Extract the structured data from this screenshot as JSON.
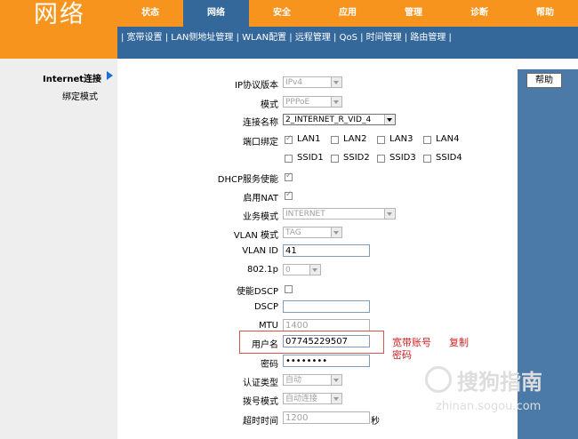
{
  "header": {
    "logo": "网络",
    "nav": [
      "状态",
      "网络",
      "安全",
      "应用",
      "管理",
      "诊断",
      "帮助"
    ],
    "active_nav": "网络",
    "subnav": "| 宽带设置 | LAN侧地址管理 | WLAN配置 | 远程管理 | QoS | 时间管理 | 路由管理 |"
  },
  "sidebar": {
    "items": [
      "Internet连接",
      "绑定模式"
    ]
  },
  "help_button": "帮助",
  "form": {
    "ip_version": {
      "label": "IP协议版本",
      "value": "IPv4"
    },
    "mode": {
      "label": "模式",
      "value": "PPPoE"
    },
    "connection_name": {
      "label": "连接名称",
      "value": "2_INTERNET_R_VID_4"
    },
    "port_binding": {
      "label": "端口绑定",
      "ports": [
        {
          "name": "LAN1",
          "checked": true
        },
        {
          "name": "LAN2",
          "checked": false
        },
        {
          "name": "LAN3",
          "checked": false
        },
        {
          "name": "LAN4",
          "checked": false
        },
        {
          "name": "SSID1",
          "checked": false
        },
        {
          "name": "SSID2",
          "checked": false
        },
        {
          "name": "SSID3",
          "checked": false
        },
        {
          "name": "SSID4",
          "checked": false
        }
      ]
    },
    "dhcp": {
      "label": "DHCP服务使能",
      "checked": true
    },
    "nat": {
      "label": "启用NAT",
      "checked": true
    },
    "service_mode": {
      "label": "业务模式",
      "value": "INTERNET"
    },
    "vlan_mode": {
      "label": "VLAN 模式",
      "value": "TAG"
    },
    "vlan_id": {
      "label": "VLAN ID",
      "value": "41"
    },
    "dot1p": {
      "label": "802.1p",
      "value": "0"
    },
    "dscp_enable": {
      "label": "使能DSCP",
      "checked": false
    },
    "dscp": {
      "label": "DSCP",
      "value": ""
    },
    "mtu": {
      "label": "MTU",
      "value": "1400"
    },
    "username": {
      "label": "用户名",
      "value": "07745229507"
    },
    "password": {
      "label": "密码",
      "value": "••••••••"
    },
    "auth_type": {
      "label": "认证类型",
      "value": "自动"
    },
    "dial_mode": {
      "label": "拨号模式",
      "value": "自动连接"
    },
    "timeout": {
      "label": "超时时间",
      "value": "1200",
      "unit": "秒"
    }
  },
  "annotations": {
    "note1": "宽带账号",
    "note2": "复制",
    "note3": "密码"
  },
  "watermark": {
    "text": "搜狗指南",
    "url": "zhinan.sogou.com"
  },
  "colors": {
    "orange": "#f7941d",
    "nav_blue": "#34679a",
    "annotation_red": "#cc2222"
  }
}
